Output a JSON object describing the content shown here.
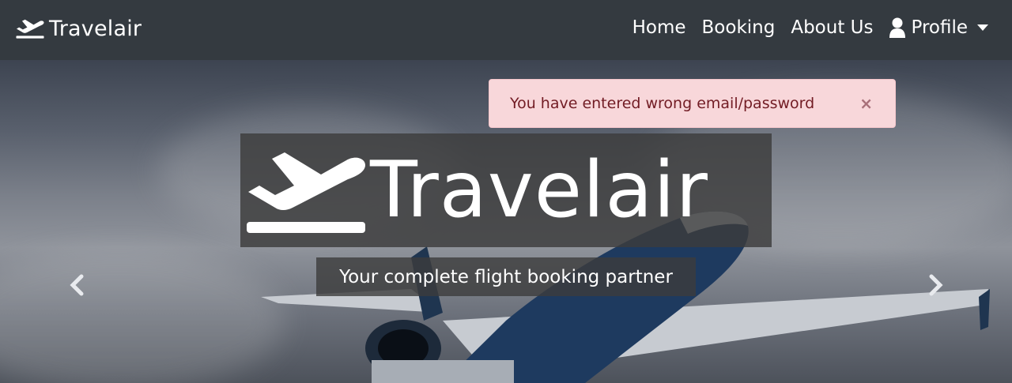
{
  "navbar": {
    "brand": "Travelair",
    "links": [
      "Home",
      "Booking",
      "About Us"
    ],
    "profile_label": "Profile"
  },
  "alert": {
    "message": "You have entered wrong email/password",
    "close_symbol": "×"
  },
  "hero": {
    "title": "Travelair",
    "subtitle": "Your complete flight booking partner"
  },
  "icons": {
    "brand": "plane-departure-icon",
    "profile": "user-icon",
    "profile_dropdown": "caret-down-icon",
    "prev": "chevron-left-icon",
    "next": "chevron-right-icon"
  },
  "colors": {
    "navbar_bg": "#343a40",
    "alert_bg": "#f8d7da",
    "alert_text": "#721c24"
  }
}
